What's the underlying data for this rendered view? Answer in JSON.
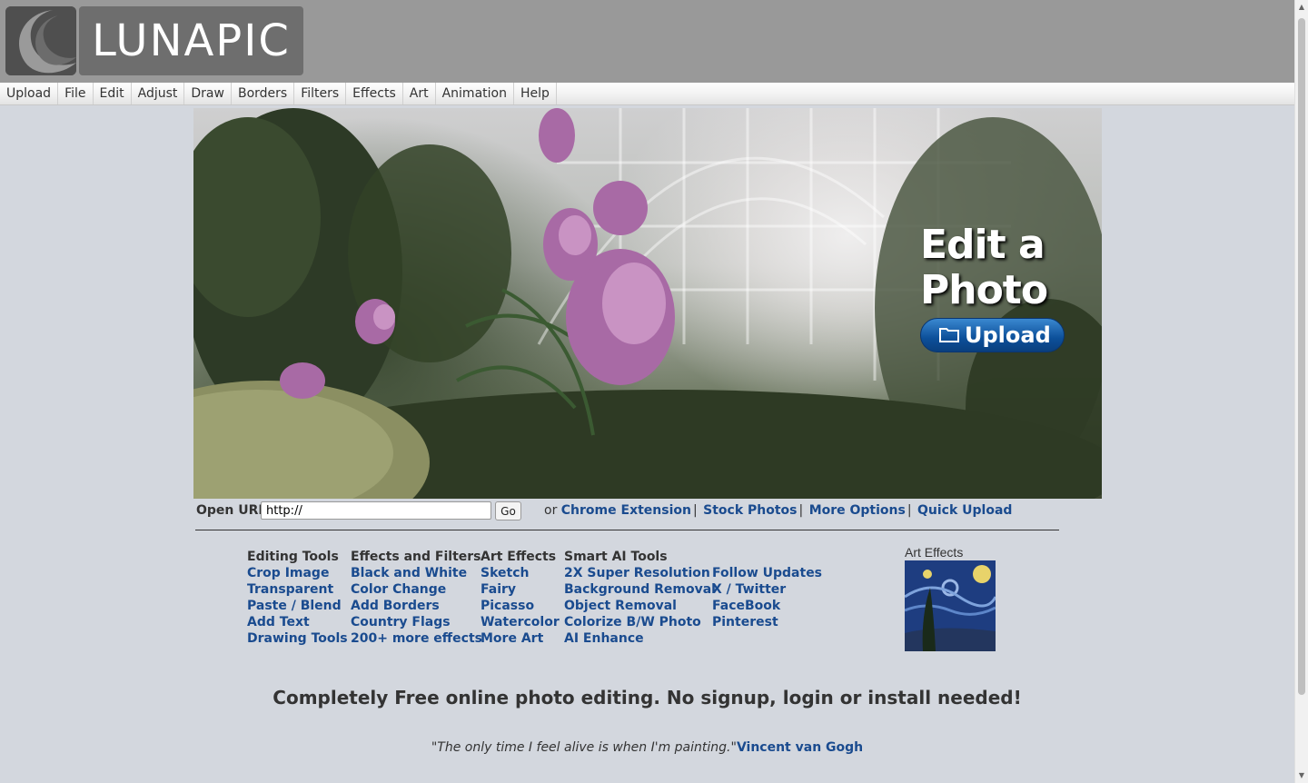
{
  "brand": {
    "logo_text": "LUNAPIC"
  },
  "menu": [
    "Upload",
    "File",
    "Edit",
    "Adjust",
    "Draw",
    "Borders",
    "Filters",
    "Effects",
    "Art",
    "Animation",
    "Help"
  ],
  "hero": {
    "title_line1": "Edit a",
    "title_line2": "Photo",
    "upload_label": "Upload"
  },
  "url_row": {
    "label": "Open URL:",
    "input_value": "http://",
    "go_label": "Go",
    "or_text": "or",
    "links": [
      "Chrome Extension",
      "Stock Photos",
      "More Options",
      "Quick Upload"
    ]
  },
  "columns": [
    {
      "heading": "Editing Tools",
      "links": [
        "Crop Image",
        "Transparent",
        "Paste / Blend",
        "Add Text",
        "Drawing Tools"
      ]
    },
    {
      "heading": "Effects and Filters",
      "links": [
        "Black and White",
        "Color Change",
        "Add Borders",
        "Country Flags",
        "200+ more effects"
      ]
    },
    {
      "heading": "Art Effects",
      "links": [
        "Sketch",
        "Fairy",
        "Picasso",
        "Watercolor",
        "More Art"
      ]
    },
    {
      "heading": "Smart AI Tools",
      "links": [
        "2X Super Resolution",
        "Background Removal",
        "Object Removal",
        "Colorize B/W Photo",
        "AI Enhance"
      ]
    },
    {
      "heading": "",
      "links": [
        "Follow Updates",
        "X / Twitter",
        "FaceBook",
        "Pinterest"
      ]
    }
  ],
  "art_effects": {
    "label": "Art Effects"
  },
  "tagline": "Completely Free online photo editing. No signup, login or install needed!",
  "quote": {
    "text": "\"The only time I feel alive is when I'm painting.\"",
    "author": "Vincent van Gogh"
  },
  "colors": {
    "header_bg": "#999999",
    "page_bg": "#d3d7de",
    "link": "#1a4b8f",
    "upload_button": "#0c4f99"
  }
}
